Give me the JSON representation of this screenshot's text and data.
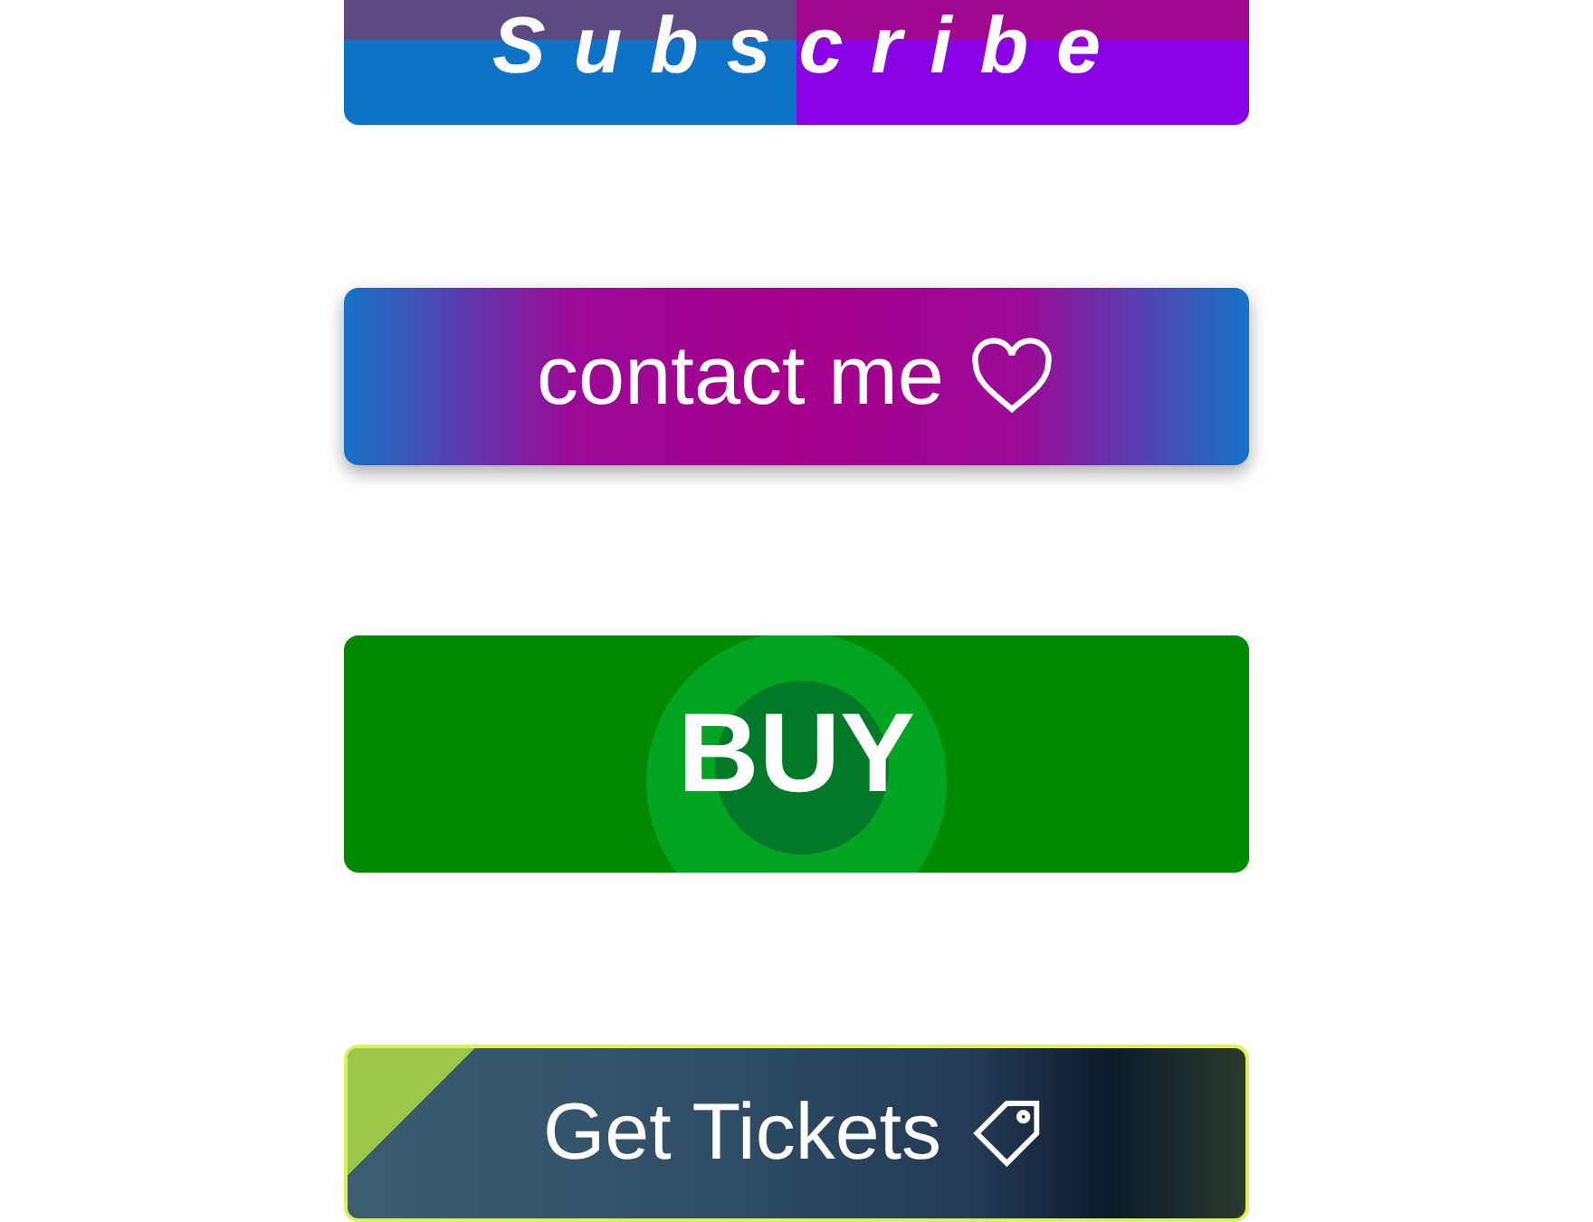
{
  "buttons": [
    {
      "kind": "split",
      "label": "Subscribe"
    },
    {
      "kind": "gradient",
      "label": "contact me"
    },
    {
      "kind": "ripple",
      "label": "BUY"
    },
    {
      "kind": "photo",
      "label": "Get Tickets"
    }
  ]
}
